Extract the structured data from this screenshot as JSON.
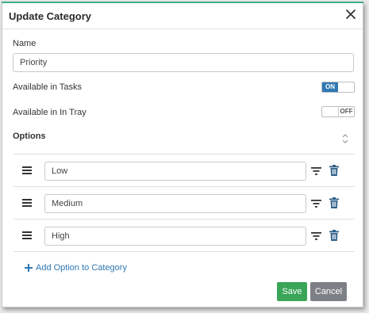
{
  "dialog": {
    "title": "Update Category",
    "name_label": "Name",
    "name_value": "Priority",
    "available_tasks_label": "Available in Tasks",
    "available_tasks_toggle": "ON",
    "available_intray_label": "Available in In Tray",
    "available_intray_toggle": "OFF",
    "options_label": "Options",
    "options": [
      {
        "value": "Low"
      },
      {
        "value": "Medium"
      },
      {
        "value": "High"
      }
    ],
    "add_option_label": "Add Option to Category",
    "save_label": "Save",
    "cancel_label": "Cancel"
  },
  "colors": {
    "accent_blue": "#2f78b4",
    "save_green": "#3aa457",
    "cancel_gray": "#7d8086",
    "delete_blue": "#2e5f8a",
    "top_border_green": "#3fae8a"
  },
  "icons": [
    "close-icon",
    "sort-icon",
    "drag-handle-icon",
    "filter-icon",
    "trash-icon",
    "plus-icon"
  ]
}
